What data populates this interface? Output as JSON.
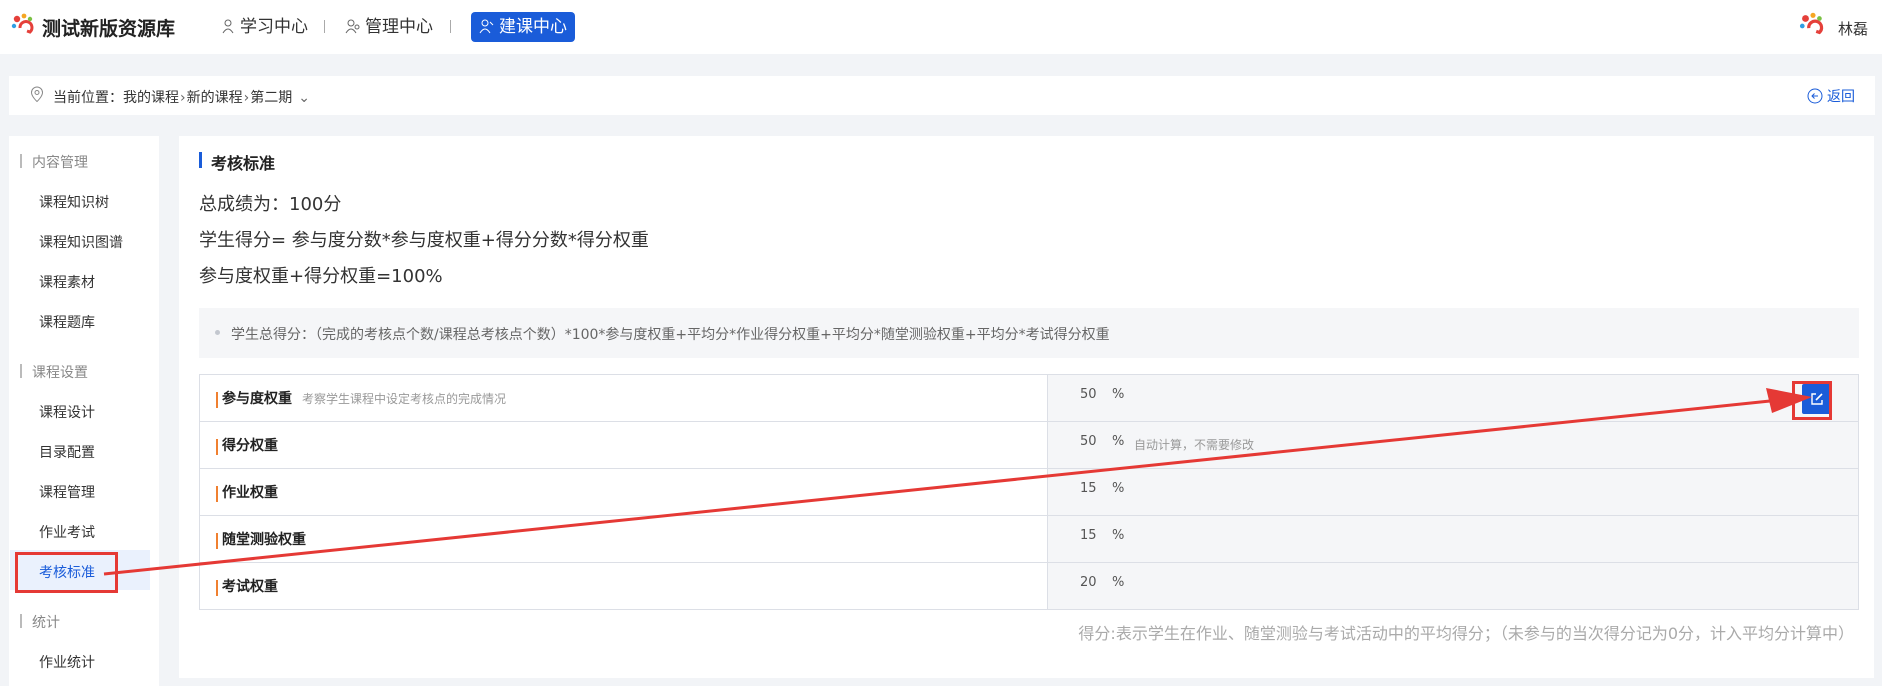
{
  "header": {
    "brand": "测试新版资源库",
    "nav": [
      {
        "label": "学习中心",
        "active": false
      },
      {
        "label": "管理中心",
        "active": false
      },
      {
        "label": "建课中心",
        "active": true
      }
    ],
    "user": "林磊"
  },
  "breadcrumb": {
    "prefix": "当前位置：",
    "items": [
      "我的课程",
      "新的课程",
      "第二期"
    ],
    "back": "返回"
  },
  "sidebar": {
    "groups": [
      {
        "title": "内容管理",
        "items": [
          "课程知识树",
          "课程知识图谱",
          "课程素材",
          "课程题库"
        ]
      },
      {
        "title": "课程设置",
        "items": [
          "课程设计",
          "目录配置",
          "课程管理",
          "作业考试",
          "考核标准"
        ]
      },
      {
        "title": "统计",
        "items": [
          "作业统计"
        ]
      }
    ],
    "active_item": "考核标准"
  },
  "main": {
    "title": "考核标准",
    "line1": "总成绩为：100分",
    "line2": "学生得分= 参与度分数*参与度权重+得分分数*得分权重",
    "line3": "参与度权重+得分权重=100%",
    "note": "学生总得分：（完成的考核点个数/课程总考核点个数）*100*参与度权重+平均分*作业得分权重+平均分*随堂测验权重+平均分*考试得分权重",
    "rows": [
      {
        "label": "参与度权重",
        "desc": "考察学生课程中设定考核点的完成情况",
        "value": "50",
        "unit": "%",
        "hint": ""
      },
      {
        "label": "得分权重",
        "desc": "",
        "value": "50",
        "unit": "%",
        "hint": "自动计算，不需要修改"
      },
      {
        "label": "作业权重",
        "desc": "",
        "value": "15",
        "unit": "%",
        "hint": ""
      },
      {
        "label": "随堂测验权重",
        "desc": "",
        "value": "15",
        "unit": "%",
        "hint": ""
      },
      {
        "label": "考试权重",
        "desc": "",
        "value": "20",
        "unit": "%",
        "hint": ""
      }
    ],
    "footer": "得分:表示学生在作业、随堂测验与考试活动中的平均得分；（未参与的当次得分记为0分，计入平均分计算中）"
  },
  "colors": {
    "accent": "#1a5cd9",
    "annotation": "#e53935",
    "row_marker": "#f08030"
  }
}
